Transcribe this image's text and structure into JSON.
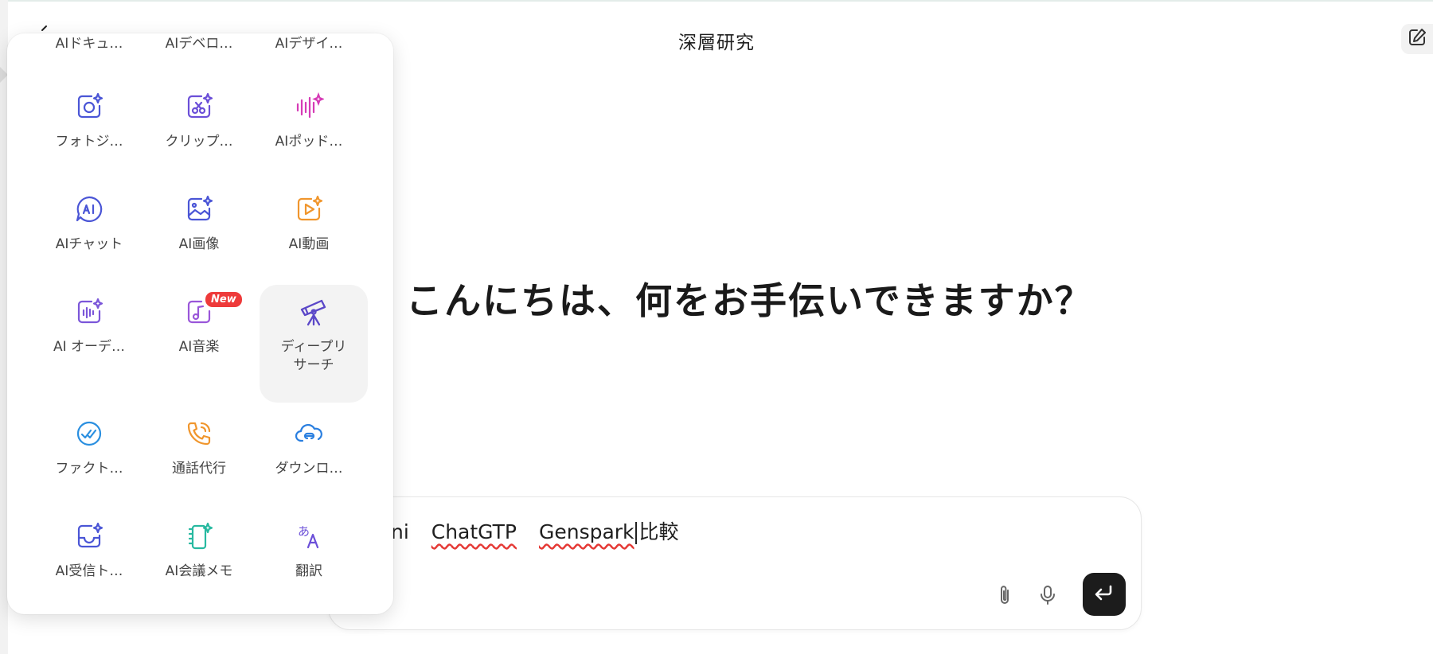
{
  "header": {
    "title": "深層研究"
  },
  "main": {
    "greeting": "こんにちは、何をお手伝いできますか？"
  },
  "input": {
    "words": [
      "ni",
      "ChatGTP",
      "Genspark"
    ],
    "tail": "比較"
  },
  "tools": {
    "top_row": [
      "AIドキュ…",
      "AIデベロ…",
      "AIデザイ…"
    ],
    "items": [
      {
        "label": "フォトジ…",
        "icon": "photo-genius-icon",
        "color": "#4a55d6"
      },
      {
        "label": "クリップ…",
        "icon": "clip-icon",
        "color": "#6b4fd8"
      },
      {
        "label": "AIポッド…",
        "icon": "podcast-waveform-icon",
        "color": "#d63bb6"
      },
      {
        "label": "AIチャット",
        "icon": "ai-chat-icon",
        "color": "#4a55d6"
      },
      {
        "label": "AI画像",
        "icon": "ai-image-icon",
        "color": "#4a55d6"
      },
      {
        "label": "AI動画",
        "icon": "ai-video-icon",
        "color": "#f0962d"
      },
      {
        "label": "AI オーデ…",
        "icon": "ai-audio-icon",
        "color": "#7b56d9"
      },
      {
        "label": "AI音楽",
        "icon": "ai-music-icon",
        "color": "#9a56d9",
        "badge": "New"
      },
      {
        "label": "ディープリサーチ",
        "label_line1": "ディープリ",
        "label_line2": "サーチ",
        "icon": "telescope-icon",
        "color": "#6b4fd8"
      },
      {
        "label": "ファクト…",
        "icon": "fact-check-icon",
        "color": "#2a8fe0"
      },
      {
        "label": "通話代行",
        "icon": "phone-call-icon",
        "color": "#f0962d"
      },
      {
        "label": "ダウンロ…",
        "icon": "cloud-download-icon",
        "color": "#2a7fe0"
      },
      {
        "label": "AI受信ト…",
        "icon": "ai-inbox-icon",
        "color": "#4a55d6"
      },
      {
        "label": "AI会議メモ",
        "icon": "meeting-notes-icon",
        "color": "#27b9a0"
      },
      {
        "label": "翻訳",
        "icon": "translate-icon",
        "color": "#6b4fd8"
      }
    ]
  }
}
